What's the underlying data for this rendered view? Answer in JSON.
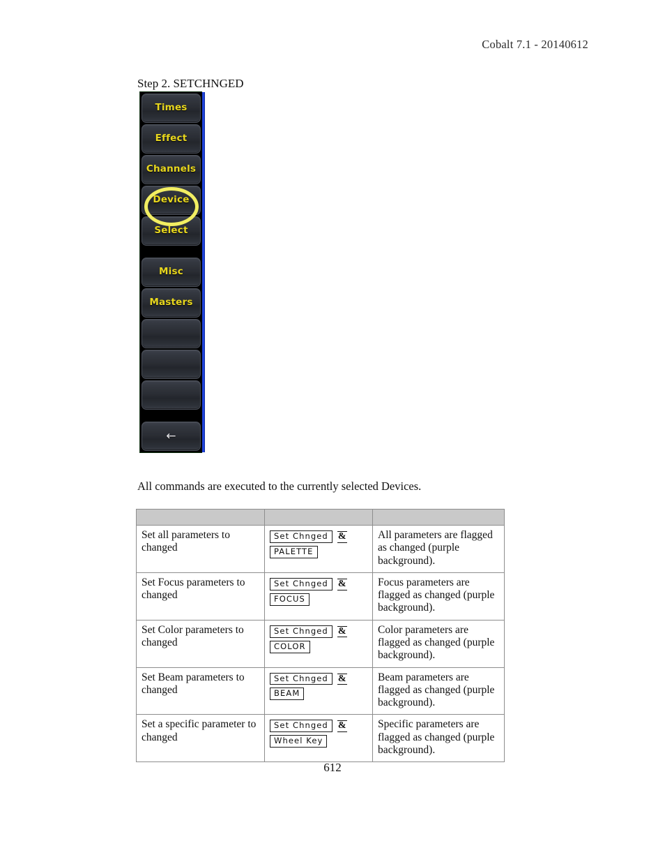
{
  "header": {
    "version_line": "Cobalt 7.1 - 20140612"
  },
  "step": {
    "caption": "Step 2. SETCHNGED"
  },
  "console_panel": {
    "buttons": [
      {
        "label": "Times",
        "state": "normal"
      },
      {
        "label": "Effect",
        "state": "normal"
      },
      {
        "label": "Channels",
        "state": "normal"
      },
      {
        "label": "Device",
        "state": "highlighted"
      },
      {
        "label": "Select",
        "state": "normal"
      },
      {
        "label": "Misc",
        "state": "normal"
      },
      {
        "label": "Masters",
        "state": "normal"
      },
      {
        "label": "",
        "state": "blank"
      },
      {
        "label": "",
        "state": "blank"
      },
      {
        "label": "",
        "state": "blank"
      },
      {
        "label": "←",
        "state": "arrow"
      }
    ],
    "highlight_target": "Device",
    "highlight_color": "#f2ee62",
    "label_color": "#e8d71e",
    "edge_color": "#2048e8"
  },
  "body": {
    "paragraph": "All commands are executed to the currently selected Devices."
  },
  "table": {
    "headers": [
      "",
      "",
      ""
    ],
    "rows": [
      {
        "action": "Set all parameters to changed",
        "key1": "Set Chnged",
        "conjunction": "&",
        "key2": "PALETTE",
        "result": "All parameters are flagged as changed (purple background)."
      },
      {
        "action": "Set Focus parameters to changed",
        "key1": "Set Chnged",
        "conjunction": "&",
        "key2": "FOCUS",
        "result": "Focus parameters are flagged as changed (purple background)."
      },
      {
        "action": "Set Color parameters to changed",
        "key1": "Set Chnged",
        "conjunction": "&",
        "key2": "COLOR",
        "result": "Color parameters are flagged as changed (purple background)."
      },
      {
        "action": "Set Beam parameters to changed",
        "key1": "Set Chnged",
        "conjunction": "&",
        "key2": "BEAM",
        "result": "Beam parameters are flagged as changed (purple background)."
      },
      {
        "action": "Set a specific parameter to changed",
        "key1": "Set Chnged",
        "conjunction": "&",
        "key2": "Wheel Key",
        "result": "Specific parameters are flagged as changed (purple background)."
      }
    ]
  },
  "footer": {
    "page_number": "612"
  }
}
